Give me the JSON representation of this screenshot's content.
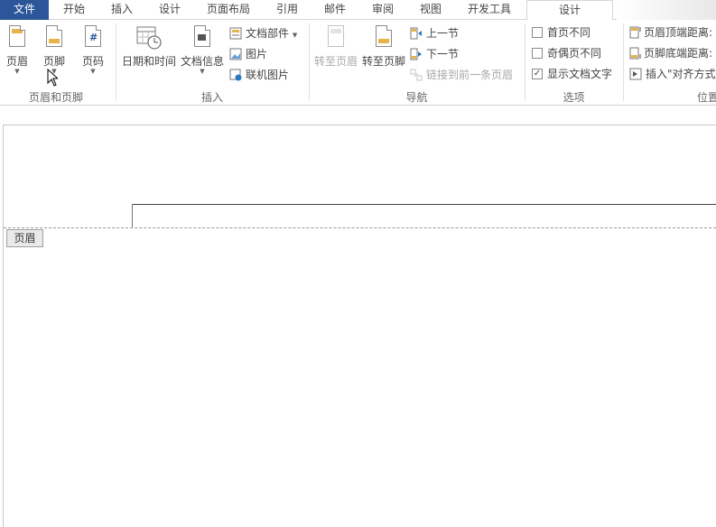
{
  "tabs": {
    "file": "文件",
    "home": "开始",
    "insert": "插入",
    "design1": "设计",
    "layout": "页面布局",
    "references": "引用",
    "mailings": "邮件",
    "review": "审阅",
    "view": "视图",
    "developer": "开发工具",
    "design_active": "设计"
  },
  "groups": {
    "header_footer": {
      "label": "页眉和页脚",
      "header": "页眉",
      "footer": "页脚",
      "page_number": "页码"
    },
    "insert": {
      "label": "插入",
      "date_time": "日期和时间",
      "doc_info": "文档信息",
      "quick_parts": "文档部件",
      "picture": "图片",
      "online_picture": "联机图片"
    },
    "navigation": {
      "label": "导航",
      "goto_header": "转至页眉",
      "goto_footer": "转至页脚",
      "prev_section": "上一节",
      "next_section": "下一节",
      "link_previous": "链接到前一条页眉"
    },
    "options": {
      "label": "选项",
      "different_first": "首页不同",
      "different_odd_even": "奇偶页不同",
      "show_doc_text": "显示文档文字",
      "show_doc_text_checked": "✓"
    },
    "position": {
      "label": "位置",
      "header_from_top": "页眉顶端距离:",
      "footer_from_bottom": "页脚底端距离:",
      "insert_align_tab": "插入\"对齐方式"
    }
  },
  "document": {
    "header_tag": "页眉"
  },
  "colors": {
    "file_tab": "#2b579a",
    "accent_band": "#e8b34a"
  }
}
